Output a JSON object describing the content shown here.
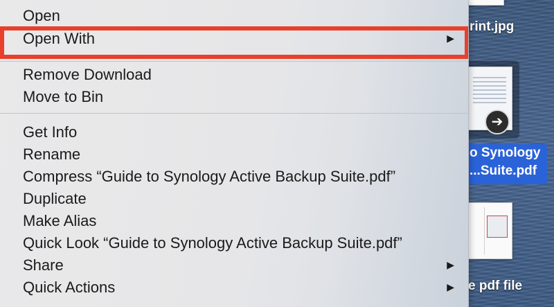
{
  "menu": {
    "items": [
      {
        "label": "Open",
        "submenu": false
      },
      {
        "label": "Open With",
        "submenu": true,
        "highlighted": true
      },
      {
        "label": "Remove Download",
        "submenu": false
      },
      {
        "label": "Move to Bin",
        "submenu": false
      },
      {
        "label": "Get Info",
        "submenu": false
      },
      {
        "label": "Rename",
        "submenu": false
      },
      {
        "label": "Compress “Guide to Synology Active Backup Suite.pdf”",
        "submenu": false
      },
      {
        "label": "Duplicate",
        "submenu": false
      },
      {
        "label": "Make Alias",
        "submenu": false
      },
      {
        "label": "Quick Look “Guide to Synology Active Backup Suite.pdf”",
        "submenu": false
      },
      {
        "label": "Share",
        "submenu": true
      },
      {
        "label": "Quick Actions",
        "submenu": true
      }
    ],
    "submenu_glyph": "▶",
    "highlight_color": "#e8402a"
  },
  "desktop": {
    "top_file_label": "rint.jpg",
    "selected_file_label_line1": "o Synology",
    "selected_file_label_line2": "...Suite.pdf",
    "low_file_label": "e pdf file",
    "badge_glyph": "➔",
    "selection_color": "#2a62d8"
  }
}
